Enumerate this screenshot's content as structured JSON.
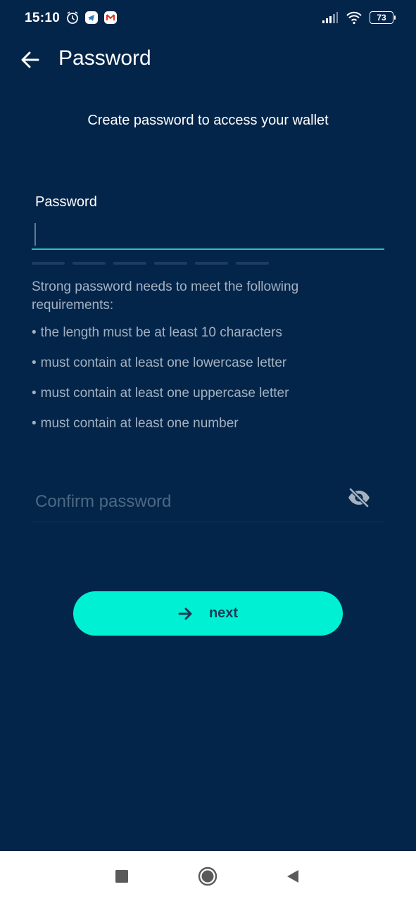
{
  "status_bar": {
    "time": "15:10",
    "battery": "73",
    "icons_left": [
      "alarm-icon",
      "telegram-icon",
      "gmail-icon"
    ],
    "icons_right": [
      "signal-icon",
      "wifi-icon",
      "battery-icon"
    ]
  },
  "header": {
    "title": "Password",
    "back_icon": "arrow-left-icon"
  },
  "subtitle": "Create password to access your wallet",
  "password_field": {
    "label": "Password",
    "value": ""
  },
  "strength_meter": {
    "segments": 6,
    "filled": 0
  },
  "requirements": {
    "intro": "Strong password needs to meet the following requirements:",
    "bullet": "•",
    "items": [
      "the length must be at least 10 characters",
      "must contain at least one lowercase letter",
      "must contain at least one uppercase letter",
      "must contain at least one number"
    ]
  },
  "confirm_field": {
    "placeholder": "Confirm password",
    "visibility_icon": "eye-off-icon"
  },
  "next_button": {
    "label": "next",
    "icon": "arrow-right-icon"
  },
  "nav_bar": {
    "icons": [
      "recents-icon",
      "home-icon",
      "back-icon"
    ]
  },
  "colors": {
    "background": "#04254a",
    "accent": "#00f0d4",
    "input_underline": "#23c6c0",
    "muted_text": "#a3b1c1",
    "button_text": "#1b3a5a"
  }
}
